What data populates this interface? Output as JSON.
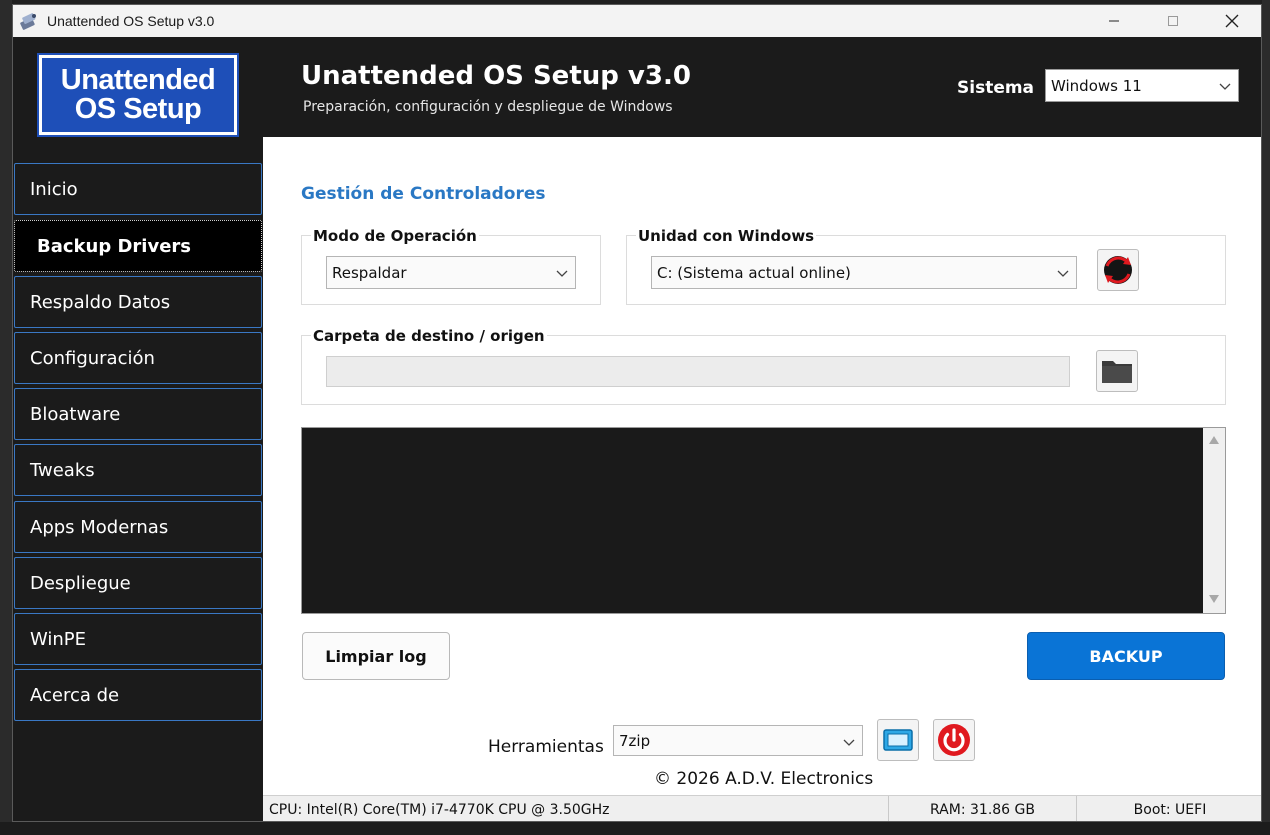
{
  "window": {
    "title": "Unattended OS Setup v3.0"
  },
  "header": {
    "logo_line1": "Unattended",
    "logo_line2": "OS Setup",
    "title": "Unattended OS Setup v3.0",
    "subtitle": "Preparación, configuración y despliegue de Windows",
    "sistema_label": "Sistema",
    "sistema_value": "Windows 11"
  },
  "sidebar": {
    "items": [
      {
        "label": "Inicio",
        "active": false
      },
      {
        "label": "Backup Drivers",
        "active": true
      },
      {
        "label": "Respaldo Datos",
        "active": false
      },
      {
        "label": "Configuración",
        "active": false
      },
      {
        "label": "Bloatware",
        "active": false
      },
      {
        "label": "Tweaks",
        "active": false
      },
      {
        "label": "Apps Modernas",
        "active": false
      },
      {
        "label": "Despliegue",
        "active": false
      },
      {
        "label": "WinPE",
        "active": false
      },
      {
        "label": "Acerca de",
        "active": false
      }
    ]
  },
  "main": {
    "section_title": "Gestión de Controladores",
    "mode_group_label": "Modo de Operación",
    "mode_value": "Respaldar",
    "drive_group_label": "Unidad con Windows",
    "drive_value": "C: (Sistema actual online)",
    "folder_group_label": "Carpeta de destino / origen",
    "folder_value": "",
    "clear_log_label": "Limpiar log",
    "backup_label": "BACKUP",
    "tools_label": "Herramientas",
    "tools_value": "7zip",
    "copyright": "© 2026 A.D.V. Electronics"
  },
  "statusbar": {
    "cpu": "CPU: Intel(R) Core(TM) i7-4770K CPU @ 3.50GHz",
    "ram": "RAM: 31.86 GB",
    "boot": "Boot: UEFI"
  },
  "colors": {
    "accent": "#0a74d6",
    "section_title": "#2a78c4",
    "header_bg": "#1b1b1b",
    "logo_bg": "#1e4fb8",
    "power_red": "#e0191f"
  }
}
